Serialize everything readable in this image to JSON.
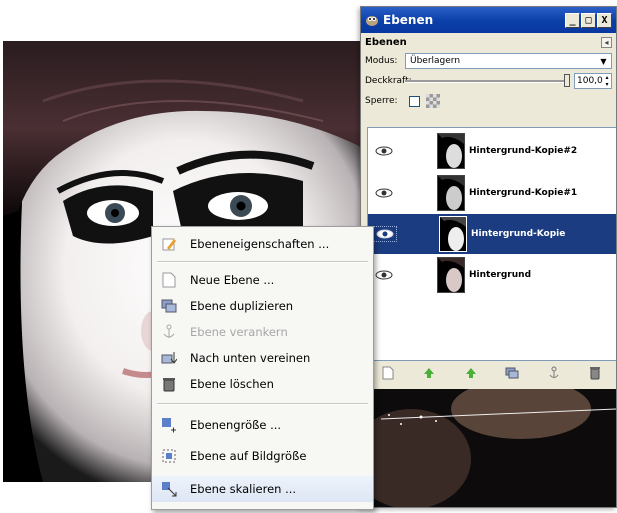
{
  "dialog": {
    "title": "Ebenen",
    "panel_title": "Ebenen",
    "modus_label": "Modus:",
    "modus_value": "Überlagern",
    "deckkraft_label": "Deckkraft:",
    "deckkraft_value": "100,0",
    "sperre_label": "Sperre:",
    "window_buttons": [
      "_",
      "□",
      "X"
    ],
    "layers": [
      {
        "name": "Hintergrund-Kopie#2",
        "selected": false
      },
      {
        "name": "Hintergrund-Kopie#1",
        "selected": false
      },
      {
        "name": "Hintergrund-Kopie",
        "selected": true
      },
      {
        "name": "Hintergrund",
        "selected": false
      }
    ],
    "bottom_icons": [
      "new-layer-icon",
      "raise-layer-icon",
      "lower-layer-icon",
      "duplicate-layer-icon",
      "anchor-layer-icon",
      "delete-layer-icon"
    ]
  },
  "context_menu": {
    "items": [
      {
        "label": "Ebeneneigenschaften ...",
        "icon": "layer-properties-icon",
        "disabled": false
      },
      {
        "label": "Neue Ebene ...",
        "icon": "new-layer-icon",
        "disabled": false
      },
      {
        "label": "Ebene duplizieren",
        "icon": "duplicate-layer-icon",
        "disabled": false
      },
      {
        "label": "Ebene verankern",
        "icon": "anchor-icon",
        "disabled": true
      },
      {
        "label": "Nach unten vereinen",
        "icon": "merge-down-icon",
        "disabled": false
      },
      {
        "label": "Ebene löschen",
        "icon": "trash-icon",
        "disabled": false
      },
      {
        "label": "Ebenengröße ...",
        "icon": "layer-size-icon",
        "disabled": false
      },
      {
        "label": "Ebene auf Bildgröße",
        "icon": "layer-to-image-size-icon",
        "disabled": false
      },
      {
        "label": "Ebene skalieren ...",
        "icon": "scale-layer-icon",
        "disabled": false
      }
    ]
  },
  "colors": {
    "titlebar": "#0b3fa8",
    "selection": "#1b3c80",
    "dialog_bg": "#ece9d8"
  }
}
